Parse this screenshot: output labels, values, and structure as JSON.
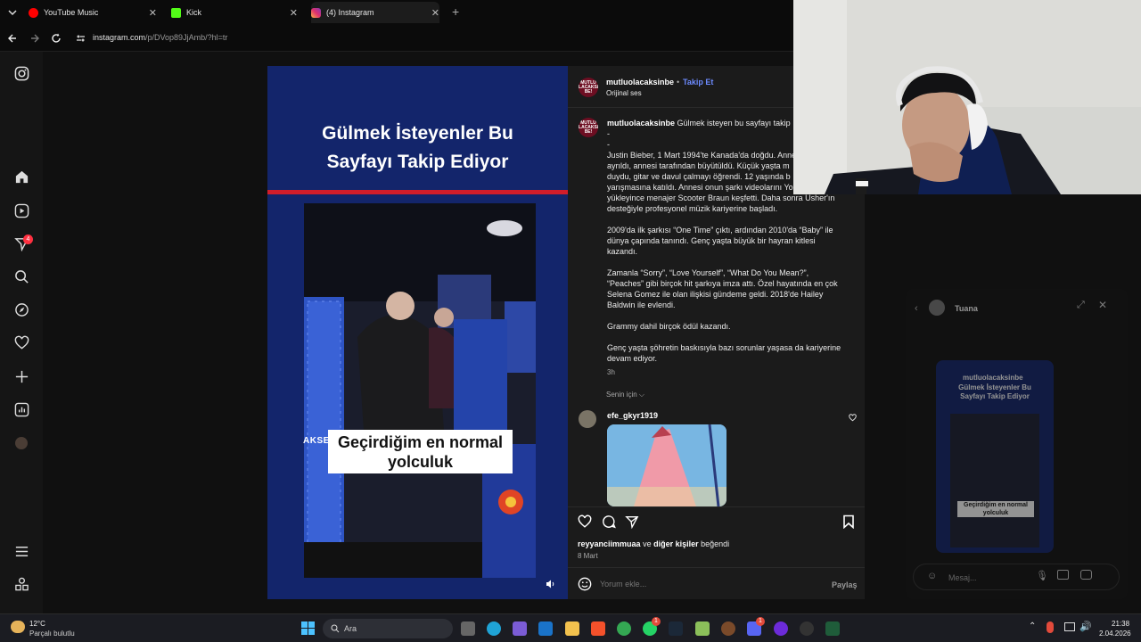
{
  "browser": {
    "tabs": [
      {
        "title": "YouTube Music",
        "color": "#ff0000"
      },
      {
        "title": "Kick",
        "color": "#53fc18"
      },
      {
        "title": "(4) Instagram",
        "color": "#e1306c"
      }
    ],
    "url_main": "instagram.com",
    "url_rest": "/p/DVop89JjAmb/?hl=tr"
  },
  "sidebar": {
    "notification_badge": "4",
    "items": [
      "instagram-logo-icon",
      "home-icon",
      "reels-icon",
      "notifications-icon",
      "search-icon",
      "explore-icon",
      "heart-icon",
      "create-icon",
      "stats-icon",
      "profile-icon",
      "menu-icon",
      "more-icon"
    ]
  },
  "reel": {
    "headline_line1": "Gülmek İsteyenler Bu",
    "headline_line2": "Sayfayı Takip Ediyor",
    "caption_line1": "Geçirdiğim en normal",
    "caption_line2": "yolculuk",
    "side_text": "AKSEN"
  },
  "post": {
    "avatar_text": "MUTLU OLACAKSIN BE!",
    "username": "mutluolacaksinbe",
    "follow": "Takip Et",
    "audio": "Orijinal ses",
    "caption_user": "mutluolacaksinbe",
    "caption_first": "Gülmek isteyen bu sayfayı takip",
    "dash1": "-",
    "dash2": "-",
    "lines_p1": [
      "Justin Bieber, 1 Mart 1994'te Kanada'da doğdu. Anne",
      "ayrıldı, annesi tarafından büyütüldü. Küçük yaşta m",
      "duydu, gitar ve davul çalmayı öğrendi. 12 yaşında b",
      "yarışmasına katıldı. Annesi onun şarkı videolarını Yo",
      "yükleyince menajer Scooter Braun keşfetti. Daha sonra Usher'ın",
      "desteğiyle profesyonel müzik kariyerine başladı."
    ],
    "lines_p2": [
      "2009'da ilk şarkısı “One Time” çıktı, ardından 2010'da “Baby” ile",
      "dünya çapında tanındı. Genç yaşta büyük bir hayran kitlesi",
      "kazandı."
    ],
    "lines_p3": [
      "Zamanla “Sorry”, “Love Yourself”, “What Do You Mean?”,",
      "“Peaches” gibi birçok hit şarkıya imza attı. Özel hayatında en çok",
      "Selena Gomez ile olan ilişkisi gündeme geldi. 2018'de Hailey",
      "Baldwin ile evlendi."
    ],
    "line_p4": "Grammy dahil birçok ödül kazandı.",
    "lines_p5": [
      "Genç yaşta şöhretin baskısıyla bazı sorunlar yaşasa da kariyerine",
      "devam ediyor."
    ],
    "time": "3h",
    "for_you": "Senin için",
    "commenter": "efe_gkyr1919",
    "liked_by_user": "reyyanciimmuaa",
    "liked_by_and": "ve",
    "liked_by_others": "diğer kişiler",
    "liked_by_end": "beğendi",
    "date": "8 Mart",
    "comment_placeholder": "Yorum ekle...",
    "share": "Paylaş"
  },
  "chat": {
    "name": "Tuana",
    "shared_user": "mutluolacaksinbe",
    "shared_headline1": "Gülmek İsteyenler Bu",
    "shared_headline2": "Sayfayı Takip Ediyor",
    "shared_caption1": "Geçirdiğim en normal",
    "shared_caption2": "yolculuk",
    "placeholder": "Mesaj..."
  },
  "taskbar": {
    "temp": "12°C",
    "weather": "Parçalı bulutlu",
    "search": "Ara",
    "time": "21:38",
    "date": "2.04.2026",
    "whatsapp_badge": "1",
    "discord_badge": "1"
  }
}
